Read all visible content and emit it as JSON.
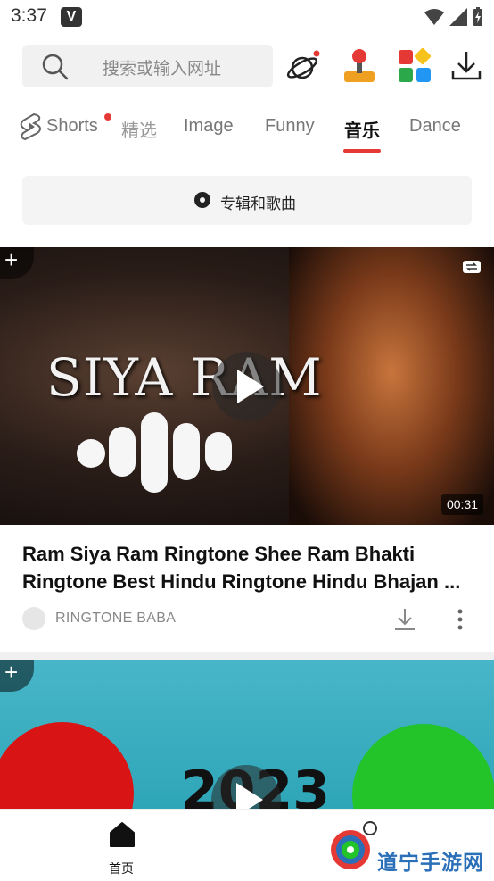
{
  "status_bar": {
    "time": "3:37",
    "app_badge": "V"
  },
  "search": {
    "placeholder": "搜索或输入网址"
  },
  "top_icons": [
    "planet-icon",
    "game-joystick-icon",
    "apps-grid-icon",
    "download-icon"
  ],
  "tabs": [
    {
      "label": "Shorts",
      "has_dot": true
    },
    {
      "label": "精选"
    },
    {
      "label": "Image"
    },
    {
      "label": "Funny"
    },
    {
      "label": "音乐",
      "active": true
    },
    {
      "label": "Dance"
    }
  ],
  "album_button": {
    "label": "专辑和歌曲"
  },
  "video1": {
    "thumb_text": "SIYA RAM",
    "duration": "00:31",
    "title_line1": "Ram Siya Ram Ringtone  Shee Ram Bhakti",
    "title_line2": "Ringtone  Best Hindu Ringtone  Hindu Bhajan  ...",
    "channel": "RINGTONE BABA"
  },
  "video2": {
    "thumb_text": "2023"
  },
  "bottom_nav": {
    "home_label": "首页"
  },
  "watermark": {
    "text": "道宁手游网"
  },
  "colors": {
    "accent": "#e53935",
    "tab_active": "#111111",
    "tab_inactive": "#777777"
  }
}
